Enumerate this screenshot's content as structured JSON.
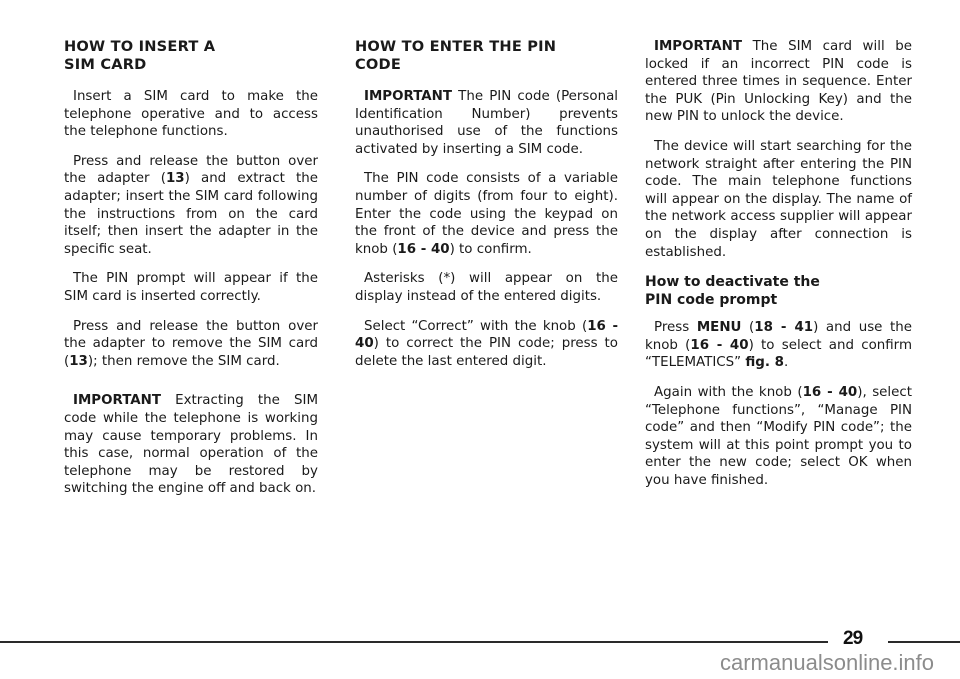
{
  "columns": {
    "c1": {
      "heading_line1": "HOW TO INSERT A",
      "heading_line2": "SIM CARD",
      "p1": "Insert a SIM card to make the telephone operative and to access the telephone functions.",
      "p2_a": "Press and release the button over the adapter (",
      "p2_ref": "13",
      "p2_b": ") and extract the adapter; insert the SIM card following the instructions from on the card itself; then insert the adapter in the specific seat.",
      "p3": "The PIN prompt will appear if the SIM card is inserted correctly.",
      "p4_a": "Press and release the button over the adapter to remove the SIM card (",
      "p4_ref": "13",
      "p4_b": "); then remove the SIM card.",
      "p5_label": "IMPORTANT",
      "p5_text": " Extracting the SIM code while the telephone is working may cause temporary problems. In this case, normal operation of the telephone may be restored by switching the engine off and back on."
    },
    "c2": {
      "heading_line1": "HOW TO ENTER THE PIN",
      "heading_line2": "CODE",
      "p1_label": "IMPORTANT",
      "p1_text": " The PIN code (Personal Identification Number) prevents unauthorised use of the functions activated by inserting a SIM code.",
      "p2_a": "The PIN code consists of a variable number of digits (from four to eight). Enter the code using the keypad on the front of the device and press the knob (",
      "p2_ref": "16 - 40",
      "p2_b": ") to confirm.",
      "p3": "Asterisks (*) will appear on the display instead of the entered digits.",
      "p4_a": "Select “Correct” with the knob (",
      "p4_ref": "16 - 40",
      "p4_b": ") to correct the PIN code; press to delete the last entered digit."
    },
    "c3": {
      "p1_label": "IMPORTANT",
      "p1_text": "  The SIM card will be locked if an incorrect PIN code is entered three times in sequence. Enter the PUK (Pin Unlocking Key) and the new PIN to unlock the device.",
      "p2": "The device will start searching for the network straight after entering the PIN code. The main telephone functions will appear on the display. The name of the network access supplier will appear on the display after connection is established.",
      "sub_line1": "How to deactivate the",
      "sub_line2": "PIN code prompt",
      "p3_a": "Press ",
      "p3_menu": "MENU",
      "p3_b": " (",
      "p3_ref1": "18 - 41",
      "p3_c": ") and use the knob (",
      "p3_ref2": "16 - 40",
      "p3_d": ") to select and confirm “TELEMATICS” ",
      "p3_fig": "fig. 8",
      "p3_e": ".",
      "p4_a": "Again with the knob (",
      "p4_ref": "16 - 40",
      "p4_b": "), select “Telephone functions”, “Manage PIN code” and then “Modify PIN code”; the system will at this point prompt you to enter the new code; select OK when you have finished."
    }
  },
  "footer": {
    "page_number": "29",
    "watermark": "carmanualsonline.info"
  }
}
